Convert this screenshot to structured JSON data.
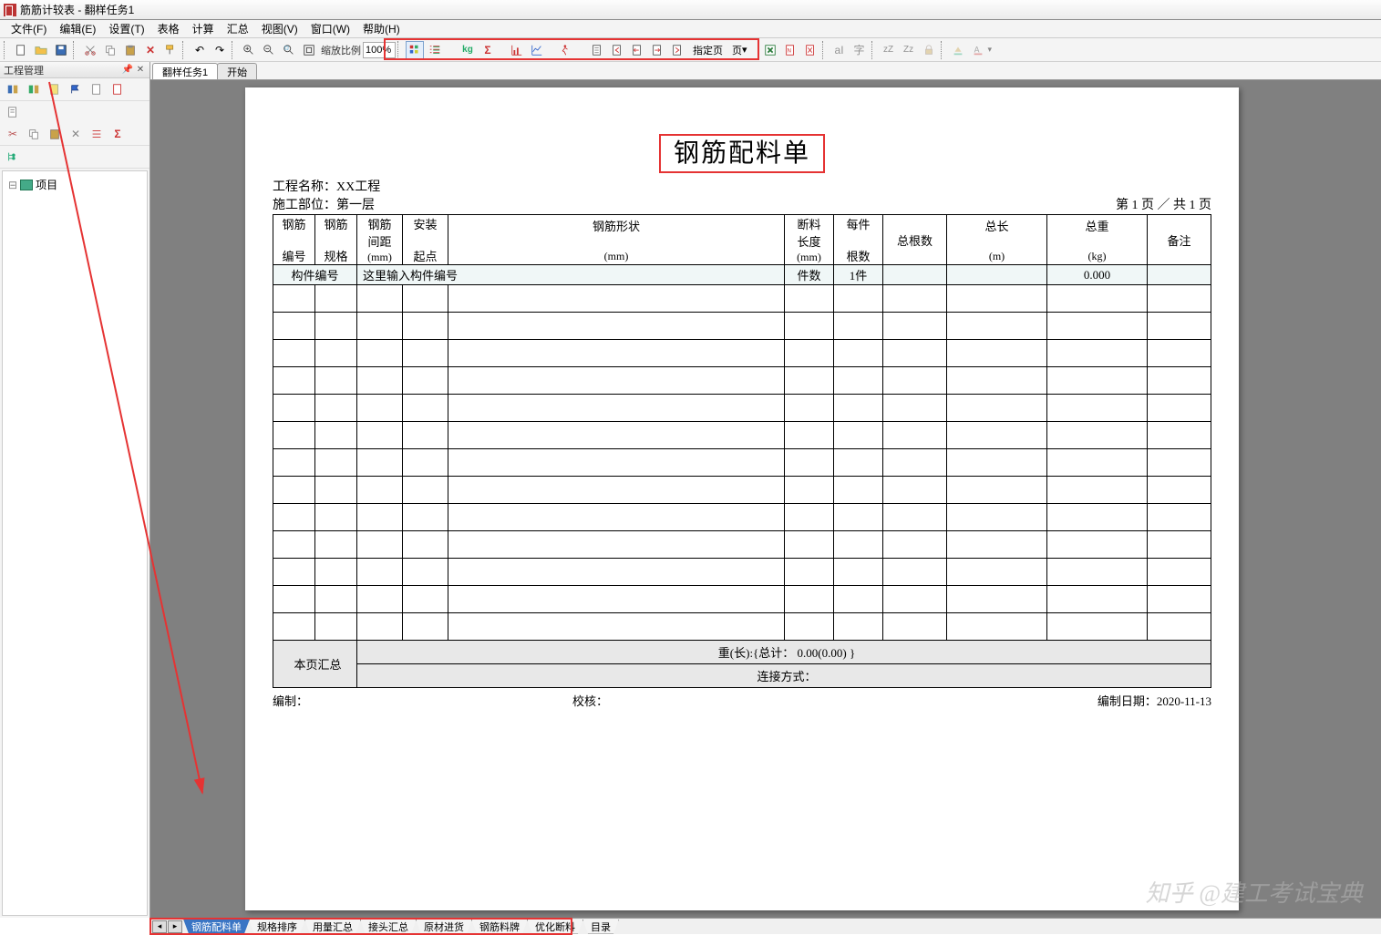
{
  "window": {
    "title": "筋筋计较表 - 翻样任务1"
  },
  "menu": [
    "文件(F)",
    "编辑(E)",
    "设置(T)",
    "表格",
    "计算",
    "汇总",
    "视图(V)",
    "窗口(W)",
    "帮助(H)"
  ],
  "toolbar": {
    "zoom_label": "缩放比例",
    "zoom_value": "100%",
    "page_btn": "指定页",
    "page_dd": "页"
  },
  "sidebar": {
    "title": "工程管理",
    "tree_item": "项目"
  },
  "doc_tabs": {
    "t1": "翻样任务1",
    "t2": "开始"
  },
  "doc": {
    "title": "钢筋配料单",
    "proj_label": "工程名称：",
    "proj_name": "XX工程",
    "part_label": "施工部位：",
    "part_name": "第一层",
    "page_info": "第 1 页 ／ 共 1 页",
    "headers": {
      "h1a": "钢筋",
      "h1b": "编号",
      "h2a": "钢筋",
      "h2b": "规格",
      "h3a": "钢筋",
      "h3b": "间距",
      "h3c": "(mm)",
      "h4a": "安装",
      "h4b": "起点",
      "h5a": "钢筋形状",
      "h5b": "(mm)",
      "h6a": "断料",
      "h6b": "长度",
      "h6c": "(mm)",
      "h7a": "每件",
      "h7b": "根数",
      "h8": "总根数",
      "h9a": "总长",
      "h9b": "(m)",
      "h10a": "总重",
      "h10b": "(kg)",
      "h11": "备注"
    },
    "sub": {
      "c1": "构件编号",
      "c2": "这里输入构件编号",
      "c3": "件数",
      "c4": "1件",
      "c5": "0.000"
    },
    "summary_label": "本页汇总",
    "summary_l1": "重(长):{总计： 0.00(0.00) }",
    "summary_l2": "连接方式：",
    "foot_l": "编制：",
    "foot_m": "校核：",
    "foot_r": "编制日期：2020-11-13"
  },
  "bottom_tabs": [
    "钢筋配料单",
    "规格排序",
    "用量汇总",
    "接头汇总",
    "原材进货",
    "钢筋料牌",
    "优化断料",
    "目录"
  ],
  "watermark": "知乎 @建工考试宝典"
}
